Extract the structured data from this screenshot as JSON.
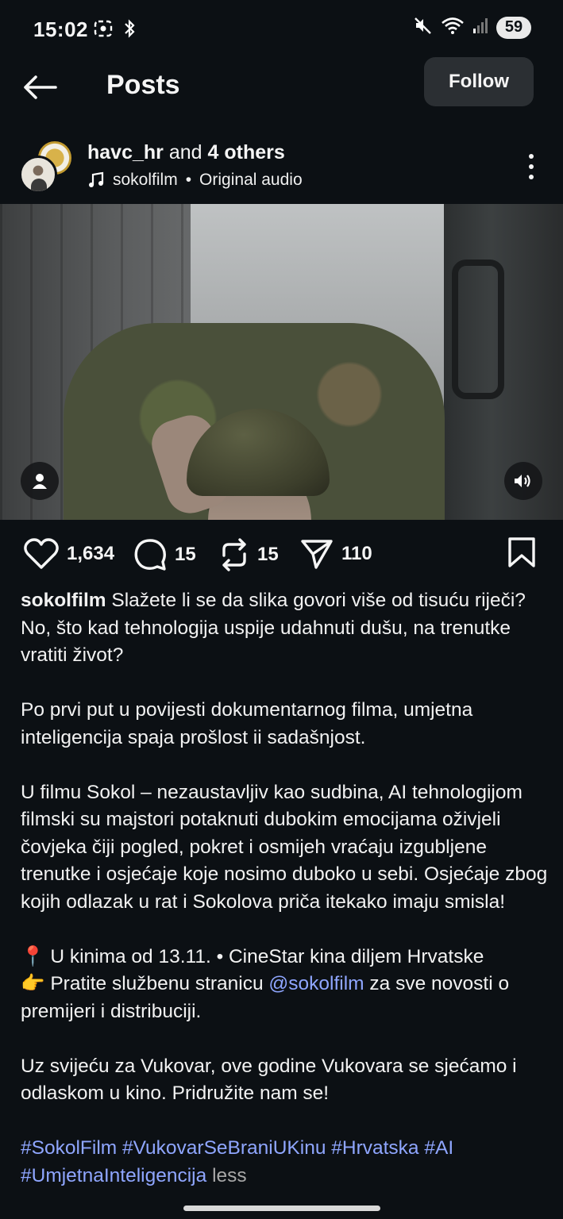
{
  "status": {
    "time": "15:02",
    "battery": "59",
    "icons": [
      "screen-record-icon",
      "bluetooth-icon",
      "mute-icon",
      "wifi-icon",
      "signal-icon"
    ]
  },
  "header": {
    "title": "Posts",
    "follow_label": "Follow"
  },
  "post": {
    "author": "havc_hr",
    "and_text": "and",
    "others": "4 others",
    "audio_owner": "sokolfilm",
    "audio_separator": "•",
    "audio_label": "Original audio"
  },
  "actions": {
    "likes": "1,634",
    "comments": "15",
    "reposts": "15",
    "shares": "110"
  },
  "caption": {
    "username": "sokolfilm",
    "p1": "Slažete li se da slika govori više od tisuću riječi? No, što kad tehnologija uspije udahnuti dušu, na trenutke vratiti život?",
    "p2": "Po prvi put u povijesti dokumentarnog filma,  umjetna inteligencija spaja prošlost ii sadašnjost.",
    "p3": "U filmu Sokol – nezaustavljiv kao sudbina, AI tehnologijom filmski su majstori potaknuti dubokim emocijama oživjeli čovjeka čiji pogled, pokret i osmijeh vraćaju izgubljene trenutke i osjećaje koje nosimo duboko u sebi. Osjećaje zbog kojih odlazak u rat i Sokolova priča itekako imaju smisla!",
    "pin_emoji": "📍",
    "pin_text": "U kinima od 13.11. • CineStar kina diljem Hrvatske",
    "point_emoji": "👉",
    "point_text_before": "Pratite službenu stranicu",
    "mention": "@sokolfilm",
    "point_text_after": "za sve novosti o premijeri i distribuciji.",
    "p5": "Uz svijeću za Vukovar, ove godine Vukovara se sjećamo i odlaskom u kino. Pridružite nam se!",
    "hashtags": "#SokolFilm #VukovarSeBraniUKinu #Hrvatska #AI #UmjetnaInteligencija",
    "less": "less"
  },
  "colors": {
    "background": "#0c1014",
    "link": "#8fa6ff",
    "follow_bg": "#2b2f33"
  }
}
